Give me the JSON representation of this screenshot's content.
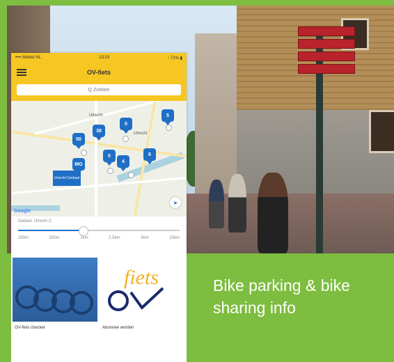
{
  "phone": {
    "status_left": "•••• Mobiel NL",
    "status_time": "13:33",
    "status_right": "↑ 71% ▮",
    "title": "OV-fiets",
    "search_placeholder": "Q Zoeken",
    "map": {
      "pins": [
        "50",
        "38",
        "5",
        "5",
        "MG",
        "0",
        "4",
        "6"
      ],
      "station_label": "Utrecht Centraal",
      "google": "Google",
      "locate_icon": "navigation-arrow-icon",
      "places": [
        "Utrecht",
        "Utrecht"
      ]
    },
    "radius": {
      "label": "Gebied: Utrecht C",
      "value_fraction": 0.4,
      "ticks": [
        "250m",
        "500m",
        "1km",
        "2,5km",
        "5km",
        "10km"
      ]
    }
  },
  "cards": [
    {
      "label": "OV-fiets checker",
      "icon": "ov-fiets-bikes-photo"
    },
    {
      "label": "Abonnee worden",
      "icon": "ov-fiets-logo",
      "logo_text": "fiets"
    }
  ],
  "caption": {
    "line1": "Bike parking & bike",
    "line2": "sharing info"
  },
  "colors": {
    "background": "#7dbd3f",
    "app_yellow": "#f6c623",
    "pin_blue": "#1f6fc6",
    "sign_red": "#b8232c"
  }
}
